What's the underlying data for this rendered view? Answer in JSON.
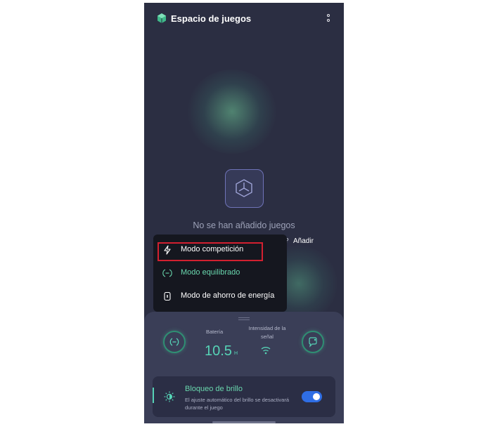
{
  "header": {
    "title": "Espacio de juegos",
    "logo_icon": "game-space-logo-icon",
    "more_icon": "more-vertical-icon"
  },
  "empty_state": {
    "icon": "game-cube-icon",
    "message": "No se han añadido juegos",
    "help_mark": "?",
    "add_label": "Añadir"
  },
  "mode_menu": {
    "items": [
      {
        "label": "Modo competición",
        "icon": "lightning-icon",
        "selected": false,
        "highlighted": true
      },
      {
        "label": "Modo equilibrado",
        "icon": "balanced-icon",
        "selected": true,
        "highlighted": false
      },
      {
        "label": "Modo de ahorro de energía",
        "icon": "battery-saver-icon",
        "selected": false,
        "highlighted": false
      }
    ]
  },
  "panel": {
    "battery_label": "Batería",
    "battery_value": "10.5",
    "battery_unit": "H",
    "signal_label": "Intensidad de la señal",
    "signal_icon": "wifi-icon",
    "left_button_icon": "balanced-mode-icon",
    "right_button_icon": "message-settings-icon"
  },
  "brightness_card": {
    "title": "Bloqueo de brillo",
    "description": "El ajuste automático del brillo se desactivará durante el juego",
    "icon": "brightness-icon",
    "enabled": true
  },
  "colors": {
    "accent": "#56d3b6",
    "background": "#2b2e42",
    "highlight": "#d32030",
    "toggle": "#2f6ee5"
  }
}
